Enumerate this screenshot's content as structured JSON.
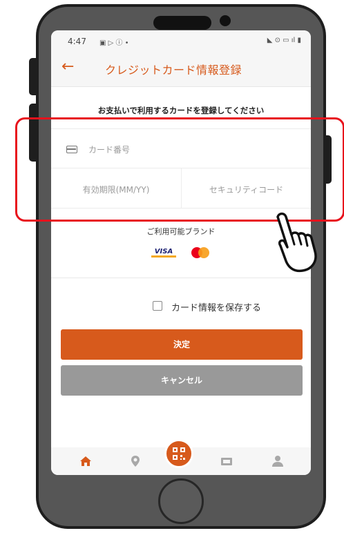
{
  "status_bar": {
    "time": "4:47",
    "left_icons": "▣ ▷ ⓘ •",
    "right_icons": "◣ ⊙ ▭ ıl ▮"
  },
  "header": {
    "back_icon": "back-arrow-icon",
    "title": "クレジットカード情報登録"
  },
  "form": {
    "instruction": "お支払いで利用するカードを登録してください",
    "card_number_placeholder": "カード番号",
    "expiry_placeholder": "有効期限(MM/YY)",
    "security_code_placeholder": "セキュリティコード"
  },
  "brands": {
    "label": "ご利用可能ブランド",
    "visa_text": "VISA",
    "items": [
      "visa-logo",
      "mastercard-logo"
    ]
  },
  "save": {
    "label": "カード情報を保存する",
    "checked": false
  },
  "actions": {
    "submit_label": "決定",
    "cancel_label": "キャンセル"
  },
  "bottom_nav": {
    "items": [
      "home-icon",
      "map-pin-icon",
      "qr-code-icon",
      "ticket-icon",
      "user-icon"
    ],
    "active": "home-icon"
  },
  "colors": {
    "accent": "#d75a1c",
    "cancel": "#999999",
    "highlight": "#e8121c"
  }
}
